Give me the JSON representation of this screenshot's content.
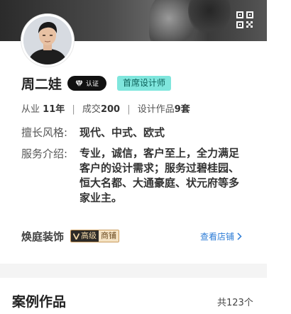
{
  "designer": {
    "name": "周二娃",
    "verify_badge": "认证",
    "title_badge": "首席设计师"
  },
  "stats": {
    "experience_label": "从业",
    "experience_value": "11年",
    "deals_label": "成交",
    "deals_value": "200",
    "works_label": "设计作品",
    "works_value": "9套"
  },
  "profile": {
    "style_label": "擅长风格:",
    "style_value": "现代、中式、欧式",
    "intro_label": "服务介绍:",
    "intro_value": "专业，诚信，客户至上，全力满足客户的设计需求；服务过碧桂园、恒大名都、大通豪庭、状元府等多家业主。"
  },
  "company": {
    "name": "焕庭装饰",
    "level_label": "高级",
    "shop_label": "商铺",
    "store_link": "查看店铺"
  },
  "cases": {
    "title": "案例作品",
    "count": "共123个"
  },
  "icons": {
    "qr": "qr-code-icon",
    "diamond": "diamond-icon",
    "chevron": "chevron-right-icon",
    "v": "v-level-icon"
  },
  "colors": {
    "title_badge_bg": "#7fe6dd",
    "link": "#2b7bd6",
    "verify_badge_bg": "#111111"
  }
}
